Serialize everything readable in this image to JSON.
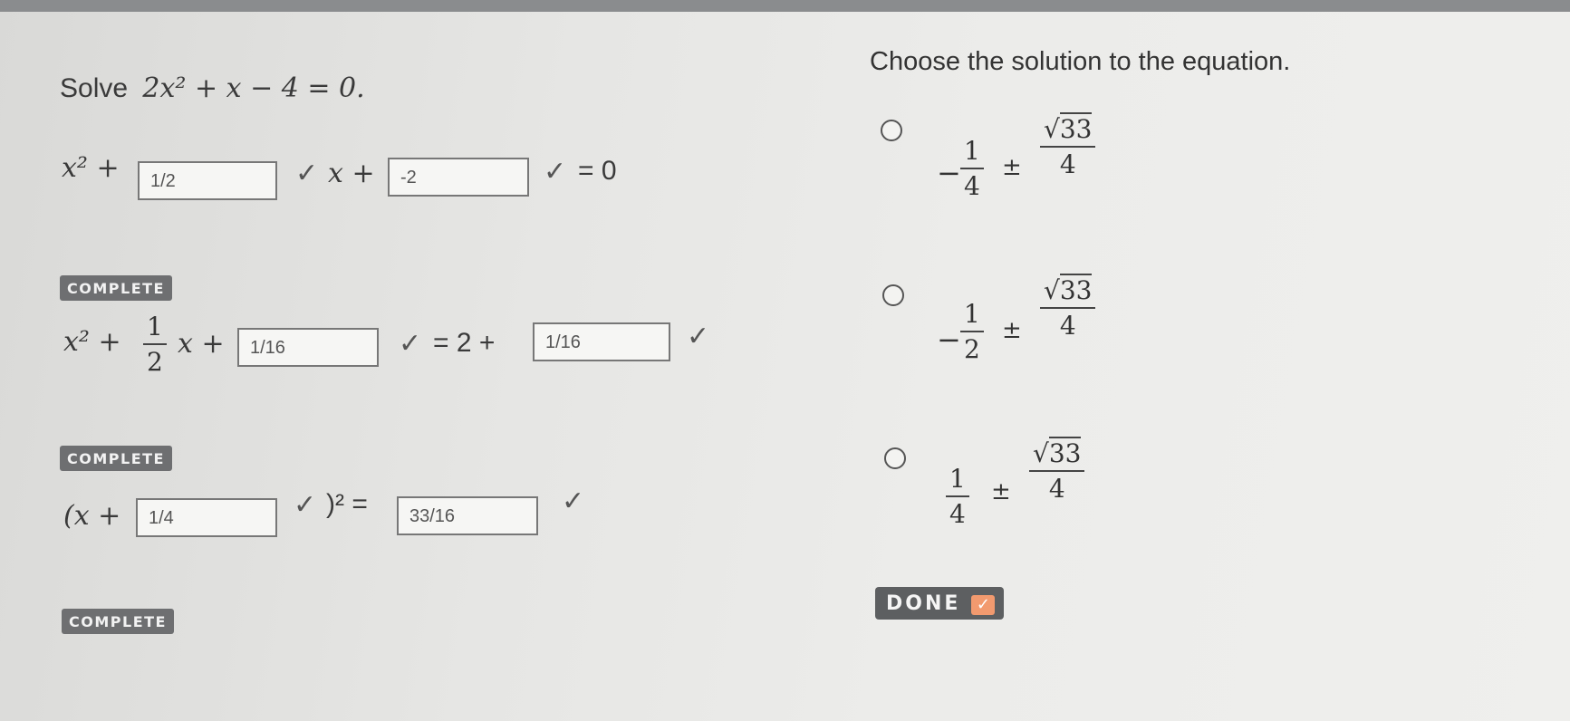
{
  "left": {
    "prompt": {
      "label": "Solve",
      "equation": "2x² + x − 4 = 0."
    },
    "step1": {
      "prefix": "x² +",
      "box1_value": "1/2",
      "mid": "x +",
      "box2_value": "-2",
      "suffix": "= 0",
      "badge": "COMPLETE"
    },
    "step2": {
      "prefix": "x² +",
      "frac_num": "1",
      "frac_den": "2",
      "after_frac": "x +",
      "box1_value": "1/16",
      "mid": "= 2 +",
      "box2_value": "1/16",
      "badge": "COMPLETE"
    },
    "step3": {
      "prefix": "(x +",
      "box1_value": "1/4",
      "mid": ")² =",
      "box2_value": "33/16",
      "badge": "COMPLETE"
    }
  },
  "right": {
    "heading": "Choose the solution to the equation.",
    "options": [
      {
        "sign": "−",
        "num": "1",
        "den": "4",
        "pm": "±",
        "rad": "33",
        "rad_den": "4"
      },
      {
        "sign": "−",
        "num": "1",
        "den": "2",
        "pm": "±",
        "rad": "33",
        "rad_den": "4"
      },
      {
        "sign": "",
        "num": "1",
        "den": "4",
        "pm": "±",
        "rad": "33",
        "rad_den": "4"
      }
    ],
    "done_label": "DONE",
    "done_check": "✓"
  },
  "check_glyph": "✓"
}
